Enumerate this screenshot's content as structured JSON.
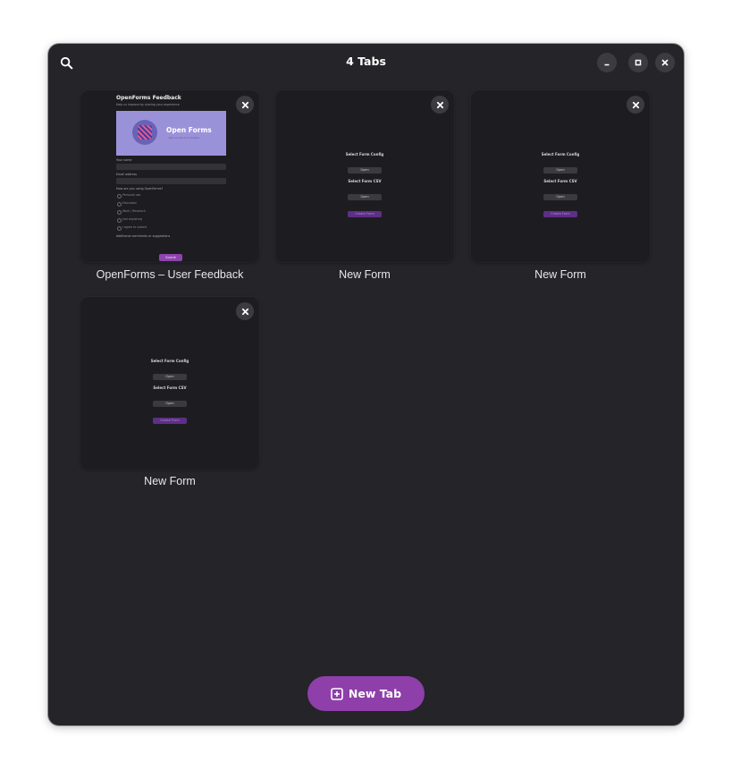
{
  "window": {
    "title": "4 Tabs"
  },
  "header": {
    "search_icon": "search-icon",
    "controls": [
      "minimize-icon",
      "maximize-icon",
      "close-icon"
    ]
  },
  "tabs": [
    {
      "label": "OpenForms – User Feedback",
      "preview": {
        "title": "OpenForms Feedback",
        "subtitle": "Help us improve by sharing your experience",
        "brand": "Open Forms",
        "brand_sub": "open source form builder",
        "fields": [
          "Your name",
          "Email address"
        ],
        "question": "How are you using OpenForms?",
        "options": [
          "Personal use",
          "Education",
          "Work / Research",
          "Just exploring",
          "I agree to submit"
        ],
        "comments_label": "Additional comments or suggestions",
        "submit": "Submit"
      }
    },
    {
      "label": "New Form",
      "preview": {
        "config_label": "Select Form Config",
        "csv_label": "Select Form CSV",
        "open": "Open",
        "create": "Create Form"
      }
    },
    {
      "label": "New Form",
      "preview": {
        "config_label": "Select Form Config",
        "csv_label": "Select Form CSV",
        "open": "Open",
        "create": "Create Form"
      }
    },
    {
      "label": "New Form",
      "preview": {
        "config_label": "Select Form Config",
        "csv_label": "Select Form CSV",
        "open": "Open",
        "create": "Create Form"
      }
    }
  ],
  "new_tab_button": {
    "label": "New Tab",
    "icon": "plus-square-icon"
  },
  "colors": {
    "window_bg": "#242429",
    "accent": "#8e3fa9",
    "card_bg": "#1d1d21"
  }
}
